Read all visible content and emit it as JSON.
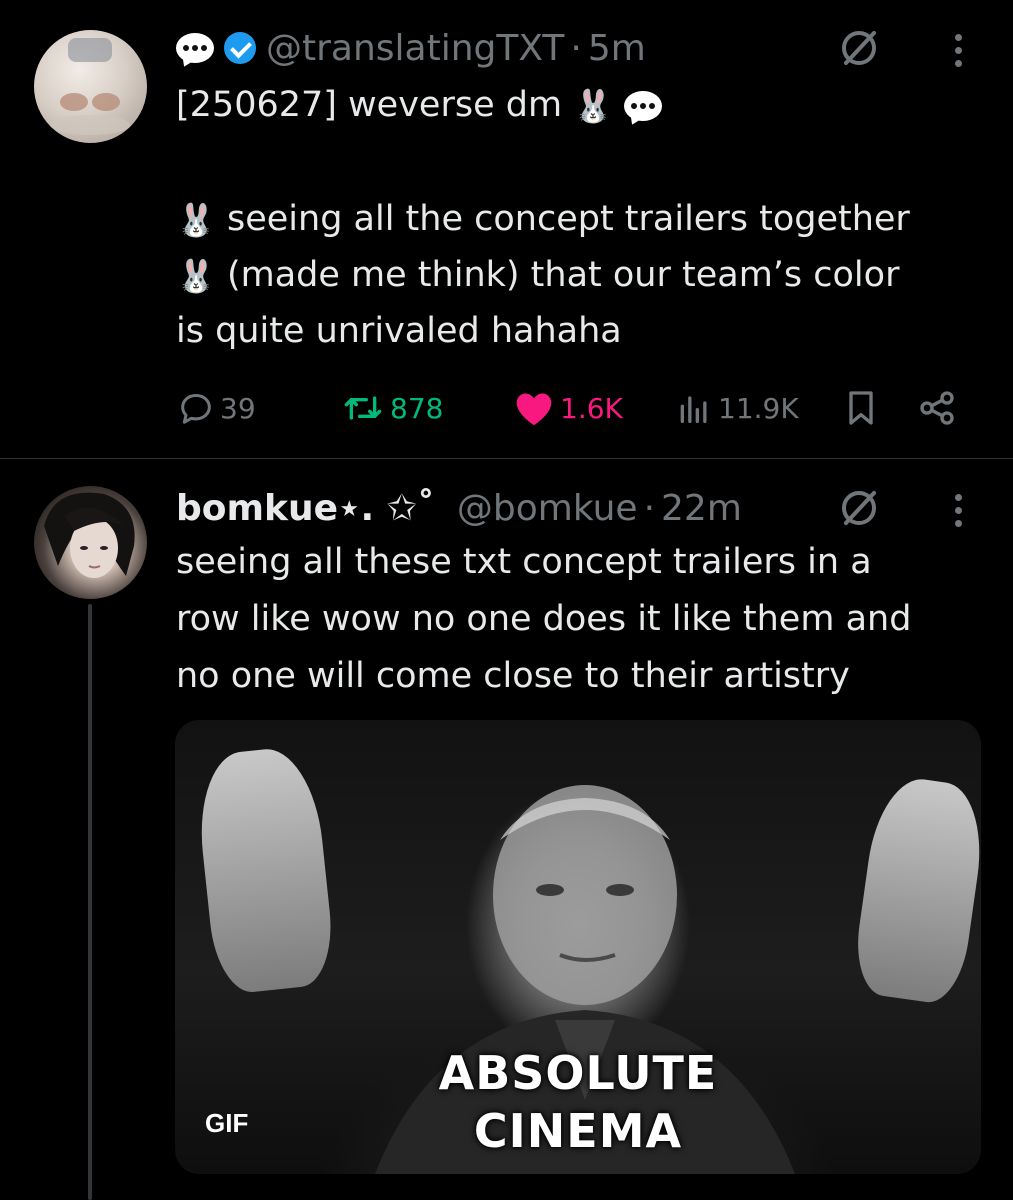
{
  "tweet1": {
    "handle": "@translatingTXT",
    "separator": "·",
    "time": "5m",
    "title_line": "[250627] weverse dm",
    "body_line1": "seeing all the concept trailers together",
    "body_line2": "(made me think) that our team’s color",
    "body_line3": "is quite unrivaled hahaha",
    "bunny_emoji": "🐰",
    "stats": {
      "replies": "39",
      "reposts": "878",
      "likes": "1.6K",
      "views": "11.9K"
    },
    "icons": [
      "speech-bubble-icon",
      "verified-badge-icon",
      "grok-icon",
      "more-icon",
      "reply-icon",
      "repost-icon",
      "like-icon",
      "views-icon",
      "bookmark-icon",
      "share-icon"
    ]
  },
  "tweet2": {
    "display_name": "bomkue⋆. ✩˚",
    "handle": "@bomkue",
    "separator": "·",
    "time": "22m",
    "body": "seeing all these txt concept trailers in a\nrow like wow no one does it like them and\nno one will come close to their artistry",
    "media": {
      "caption_line1": "ABSOLUTE",
      "caption_line2": "CINEMA",
      "badge": "GIF"
    }
  },
  "colors": {
    "background": "#000000",
    "text": "#e7e9ea",
    "muted": "#71767b",
    "repost": "#00ba7c",
    "like": "#f91880",
    "verified": "#1d9bf0"
  }
}
